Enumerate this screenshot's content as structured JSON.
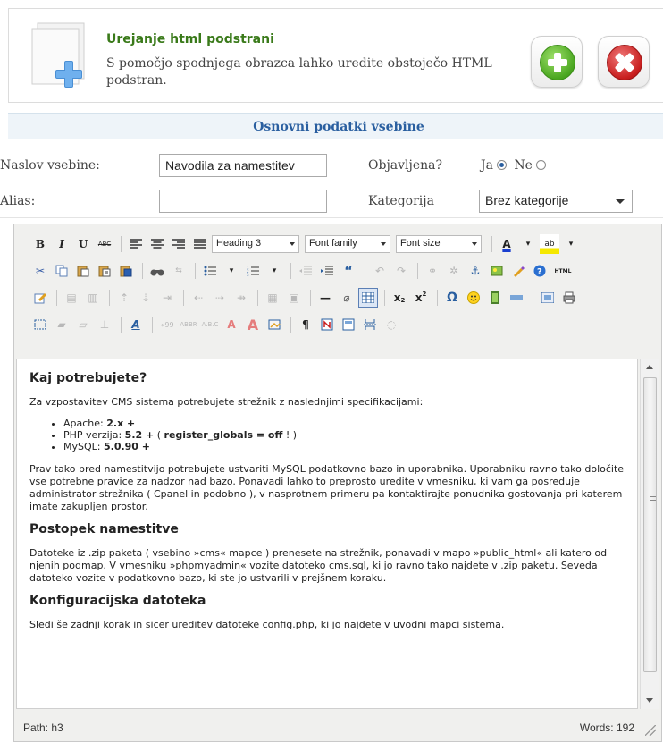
{
  "header": {
    "title": "Urejanje html podstrani",
    "description": "S pomočjo spodnjega obrazca lahko uredite obstoječo HTML podstran.",
    "add_icon": "plus-icon",
    "close_icon": "close-icon"
  },
  "section": {
    "title": "Osnovni podatki vsebine"
  },
  "form": {
    "title_label": "Naslov vsebine:",
    "title_value": "Navodila za namestitev",
    "published_label": "Objavljena?",
    "yes_label": "Ja",
    "no_label": "Ne",
    "published_selected": "Ja",
    "alias_label": "Alias:",
    "alias_value": "",
    "category_label": "Kategorija",
    "category_value": "Brez kategorije"
  },
  "editor": {
    "block_format": "Heading 3",
    "font_family": "Font family",
    "font_size": "Font size",
    "path": "Path: h3",
    "words": "Words: 192",
    "content": {
      "h1": "Kaj potrebujete?",
      "p1": "Za vzpostavitev CMS sistema potrebujete strežnik z naslednjimi specifikacijami:",
      "li1_label": "Apache: ",
      "li1_value": "2.x +",
      "li2_label": "PHP verzija: ",
      "li2_value": "5.2 +",
      "li2_open": " ( ",
      "li2_bold": "register_globals = off",
      "li2_close": " ! )",
      "li3_label": "MySQL: ",
      "li3_value": "5.0.90 +",
      "p2": "Prav tako pred namestitvijo potrebujete ustvariti MySQL podatkovno bazo in uporabnika. Uporabniku ravno tako določite vse potrebne pravice za nadzor nad bazo. Ponavadi lahko to preprosto uredite v vmesniku, ki vam ga posreduje administrator strežnika ( Cpanel in podobno ), v nasprotnem primeru pa kontaktirajte ponudnika gostovanja pri katerem imate zakupljen prostor.",
      "h2": "Postopek namestitve",
      "p3": "Datoteke iz .zip paketa ( vsebino »cms« mapce ) prenesete na strežnik, ponavadi v mapo »public_html« ali katero od njenih podmap. V vmesniku »phpmyadmin« vozite datoteko cms.sql, ki jo ravno tako najdete v .zip paketu. Seveda datoteko vozite v podatkovno bazo, ki ste jo ustvarili v prejšnem koraku.",
      "h3": "Konfiguracijska datoteka",
      "p4": "Sledi še zadnji korak in sicer ureditev datoteke config.php,  ki jo najdete v uvodni mapci sistema."
    }
  }
}
